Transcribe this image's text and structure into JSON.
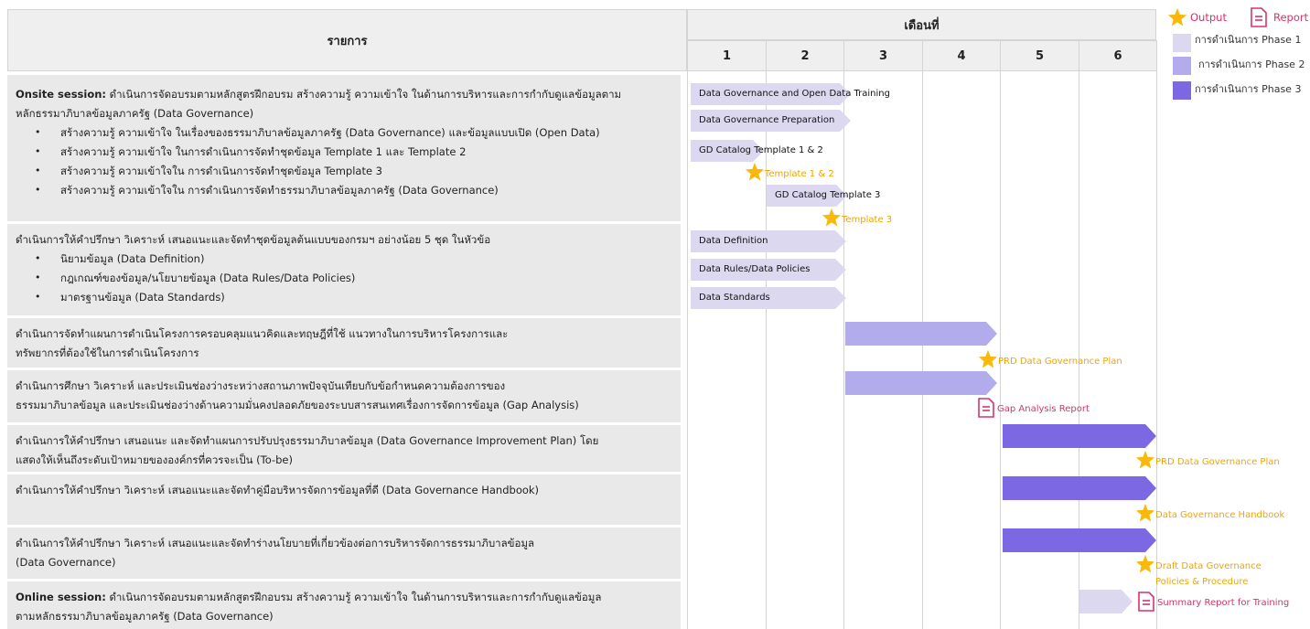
{
  "header": {
    "items_title": "รายการ",
    "months_title": "เดือนที่",
    "months": [
      "1",
      "2",
      "3",
      "4",
      "5",
      "6"
    ]
  },
  "legend": {
    "output_label": "Output",
    "report_label": "Report",
    "phase1": "การดำเนินการ Phase 1",
    "phase2": "การดำเนินการ Phase 2",
    "phase3": "การดำเนินการ Phase 3",
    "colors": {
      "phase1": "#dcd8f0",
      "phase2": "#b3acec",
      "phase3": "#7c68e2",
      "output": "#f8b90a",
      "report": "#d6336c"
    }
  },
  "rows": [
    {
      "lines": [
        "ดำเนินการจัดอบรมตามหลักสูตรฝึกอบรม สร้างความรู้ ความเข้าใจ ในด้านการบริหารและการกำกับดูแลข้อมูลตาม",
        "หลักธรรมาภิบาลข้อมูลภาครัฐ (Data Governance)"
      ],
      "bold_prefix": "Onsite session:",
      "bullets": [
        "สร้างความรู้ ความเข้าใจ ในเรื่องของธรรมาภิบาลข้อมูลภาครัฐ (Data Governance) และข้อมูลแบบเปิด (Open Data)",
        "สร้างความรู้ ความเข้าใจ ในการดำเนินการจัดทำชุดข้อมูล Template 1 และ Template 2",
        "สร้างความรู้ ความเข้าใจใน การดำเนินการจัดทำชุดข้อมูล Template 3",
        "สร้างความรู้ ความเข้าใจใน การดำเนินการจัดทำธรรมาภิบาลข้อมูลภาครัฐ (Data Governance)"
      ]
    },
    {
      "lines": [
        "ดำเนินการให้คำปรึกษา วิเคราะห์ เสนอแนะและจัดทำชุดข้อมูลต้นแบบของกรมฯ อย่างน้อย 5 ชุด ในหัวข้อ"
      ],
      "bullets": [
        "นิยามข้อมูล (Data Definition)",
        "กฎเกณฑ์ของข้อมูล/นโยบายข้อมูล (Data Rules/Data Policies)",
        "มาตรฐานข้อมูล (Data Standards)"
      ]
    },
    {
      "lines": [
        "ดำเนินการจัดทำแผนการดำเนินโครงการครอบคลุมแนวคิดและทฤษฎีที่ใช้ แนวทางในการบริหารโครงการและ",
        "ทรัพยากรที่ต้องใช้ในการดำเนินโครงการ"
      ]
    },
    {
      "lines": [
        "ดำเนินการศึกษา วิเคราะห์ และประเมินช่องว่างระหว่างสถานภาพปัจจุบันเทียบกับข้อกำหนดความต้องการของ",
        "ธรรมมาภิบาลข้อมูล และประเมินช่องว่างด้านความมั่นคงปลอดภัยของระบบสารสนเทศเรื่องการจัดการข้อมูล (Gap Analysis)"
      ]
    },
    {
      "lines": [
        "ดำเนินการให้คำปรึกษา เสนอแนะ และจัดทำแผนการปรับปรุงธรรมาภิบาลข้อมูล (Data Governance Improvement Plan) โดย",
        "แสดงให้เห็นถึงระดับเป้าหมายขององค์กรที่ควรจะเป็น (To-be)"
      ]
    },
    {
      "lines": [
        "ดำเนินการให้คำปรึกษา วิเคราะห์ เสนอแนะและจัดทำคู่มือบริหารจัดการข้อมูลที่ดี (Data Governance Handbook)"
      ]
    },
    {
      "lines": [
        "ดำเนินการให้คำปรึกษา วิเคราะห์ เสนอแนะและจัดทำร่างนโยบายที่เกี่ยวข้องต่อการบริหารจัดการธรรมาภิบาลข้อมูล",
        "(Data Governance)"
      ]
    },
    {
      "lines": [
        "ดำเนินการจัดอบรมตามหลักสูตรฝึกอบรม สร้างความรู้ ความเข้าใจ ในด้านการบริหารและการกำกับดูแลข้อมูล",
        "ตามหลักธรรมาภิบาลข้อมูลภาครัฐ (Data Governance)"
      ],
      "bold_prefix": "Online session:"
    }
  ],
  "bars": [
    {
      "label": "Data Governance and Open Data Training",
      "phase": "phase1"
    },
    {
      "label": "Data Governance Preparation",
      "phase": "phase1"
    },
    {
      "label": "GD Catalog Template 1 & 2",
      "phase": "phase1"
    },
    {
      "label": "GD Catalog Template 3",
      "phase": "phase1"
    },
    {
      "label": "Data Definition",
      "phase": "phase1"
    },
    {
      "label": "Data Rules/Data Policies",
      "phase": "phase1"
    },
    {
      "label": "Data Standards",
      "phase": "phase1"
    },
    {
      "label": "",
      "phase": "phase2"
    },
    {
      "label": "",
      "phase": "phase2"
    },
    {
      "label": "",
      "phase": "phase3"
    },
    {
      "label": "",
      "phase": "phase3"
    },
    {
      "label": "",
      "phase": "phase3"
    },
    {
      "label": "",
      "phase": "phase1"
    }
  ],
  "milestones": [
    {
      "type": "output",
      "label": "Template 1 & 2"
    },
    {
      "type": "output",
      "label": "Template 3"
    },
    {
      "type": "output",
      "label": "PRD Data Governance Plan"
    },
    {
      "type": "report",
      "label": "Gap Analysis Report"
    },
    {
      "type": "output",
      "label": "PRD Data Governance Plan"
    },
    {
      "type": "output",
      "label": "Data Governance Handbook"
    },
    {
      "type": "output",
      "label": "Draft Data Governance",
      "label2": "Policies & Procedure"
    },
    {
      "type": "report",
      "label": "Summary Report for Training"
    }
  ]
}
